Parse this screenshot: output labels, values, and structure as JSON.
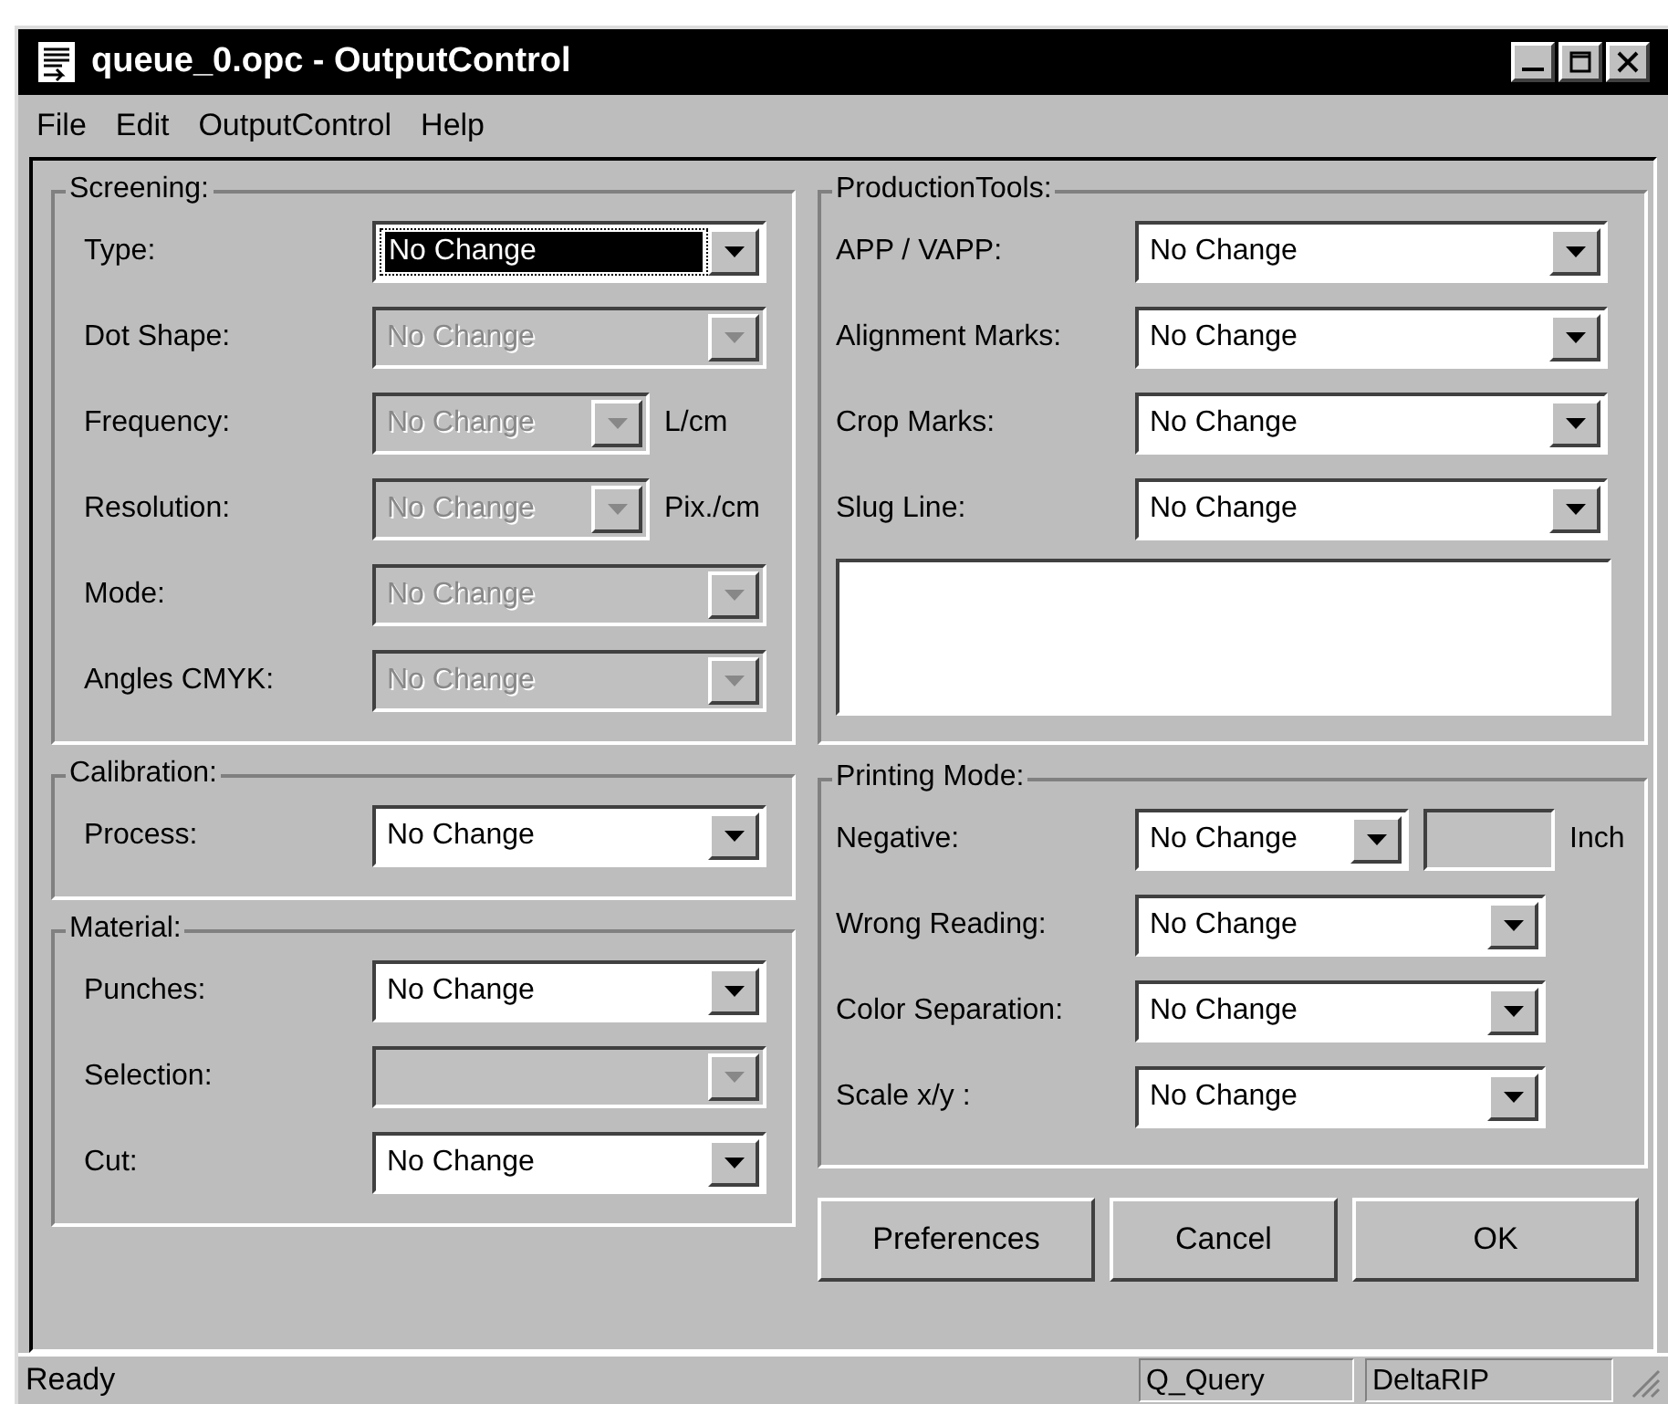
{
  "window": {
    "title": "queue_0.opc - OutputControl"
  },
  "menu": [
    "File",
    "Edit",
    "OutputControl",
    "Help"
  ],
  "groups_left": [
    {
      "title": "Screening:",
      "rows": [
        {
          "label": "Type:",
          "value": "No Change",
          "kind": "combo",
          "disabled": false,
          "focused": true
        },
        {
          "label": "Dot Shape:",
          "value": "No Change",
          "kind": "combo",
          "disabled": true,
          "focused": false
        },
        {
          "label": "Frequency:",
          "value": "No Change",
          "kind": "combo-unit",
          "unit": "L/cm",
          "disabled": true,
          "focused": false
        },
        {
          "label": "Resolution:",
          "value": "No Change",
          "kind": "combo-unit",
          "unit": "Pix./cm",
          "disabled": true,
          "focused": false
        },
        {
          "label": "Mode:",
          "value": "No Change",
          "kind": "combo",
          "disabled": true,
          "focused": false
        },
        {
          "label": "Angles CMYK:",
          "value": "No Change",
          "kind": "combo",
          "disabled": true,
          "focused": false
        }
      ]
    },
    {
      "title": "Calibration:",
      "rows": [
        {
          "label": "Process:",
          "value": "No Change",
          "kind": "combo",
          "disabled": false,
          "focused": false
        }
      ]
    },
    {
      "title": "Material:",
      "rows": [
        {
          "label": "Punches:",
          "value": "No Change",
          "kind": "combo",
          "disabled": false,
          "focused": false
        },
        {
          "label": "Selection:",
          "kind": "combo",
          "disabled": true,
          "focused": false
        },
        {
          "label": "Cut:",
          "value": "No Change",
          "kind": "combo",
          "disabled": false,
          "focused": false
        }
      ]
    }
  ],
  "groups_right": [
    {
      "title": "ProductionTools:",
      "rows": [
        {
          "label": "APP / VAPP:",
          "value": "No Change",
          "kind": "combo",
          "disabled": false,
          "focused": false
        },
        {
          "label": "Alignment Marks:",
          "value": "No Change",
          "kind": "combo",
          "disabled": false,
          "focused": false
        },
        {
          "label": "Crop Marks:",
          "value": "No Change",
          "kind": "combo",
          "disabled": false,
          "focused": false
        },
        {
          "label": "Slug Line:",
          "value": "No Change",
          "kind": "combo",
          "disabled": false,
          "focused": false
        },
        {
          "kind": "memo"
        }
      ]
    },
    {
      "title": "Printing Mode:",
      "rows": [
        {
          "label": "Negative:",
          "value": "No Change",
          "kind": "combo-field-unit",
          "unit": "Inch",
          "disabled": false,
          "focused": false
        },
        {
          "label": "Wrong Reading:",
          "value": "No Change",
          "kind": "combo",
          "disabled": false,
          "focused": false
        },
        {
          "label": "Color Separation:",
          "value": "No Change",
          "kind": "combo",
          "disabled": false,
          "focused": false
        },
        {
          "label": "Scale x/y :",
          "value": "No Change",
          "kind": "combo",
          "disabled": false,
          "focused": false
        }
      ]
    }
  ],
  "buttons": [
    "Preferences",
    "Cancel",
    "OK"
  ],
  "status_bar": {
    "message": "Ready",
    "panes": [
      "Q_Query",
      "DeltaRIP"
    ]
  }
}
